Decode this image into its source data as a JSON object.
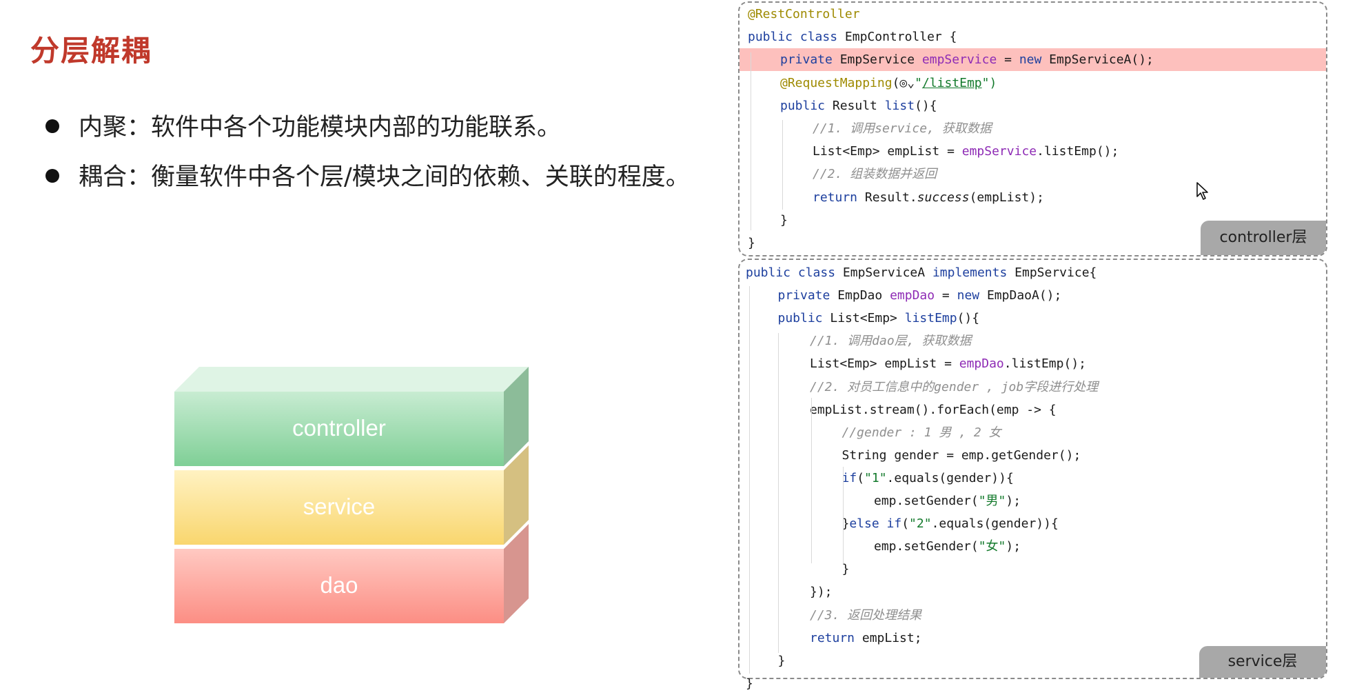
{
  "slide": {
    "title": "分层解耦",
    "bullets": [
      "内聚：软件中各个功能模块内部的功能联系。",
      "耦合：衡量软件中各个层/模块之间的依赖、关联的程度。"
    ]
  },
  "diagram": {
    "layers": [
      "controller",
      "service",
      "dao"
    ],
    "colors": {
      "controller": [
        "#c8ecd2",
        "#7fcf96"
      ],
      "service": [
        "#fff2c2",
        "#f9d66e"
      ],
      "dao": [
        "#ffc9c2",
        "#fc8e84"
      ]
    }
  },
  "controller_panel": {
    "tag": "controller层",
    "lines": [
      {
        "indent": 0,
        "tokens": [
          {
            "t": "@RestController",
            "c": "ann"
          }
        ]
      },
      {
        "indent": 0,
        "tokens": [
          {
            "t": "public class ",
            "c": "kw"
          },
          {
            "t": "EmpController {",
            "c": ""
          }
        ]
      },
      {
        "indent": 1,
        "highlight": true,
        "tokens": [
          {
            "t": "private ",
            "c": "kw"
          },
          {
            "t": "EmpService ",
            "c": ""
          },
          {
            "t": "empService",
            "c": "fld"
          },
          {
            "t": " = ",
            "c": ""
          },
          {
            "t": "new ",
            "c": "kw"
          },
          {
            "t": "EmpServiceA();",
            "c": ""
          }
        ]
      },
      {
        "indent": 1,
        "tokens": [
          {
            "t": "@RequestMapping",
            "c": "ann"
          },
          {
            "t": "(",
            "c": ""
          },
          {
            "t": "◎⌄",
            "c": "globe"
          },
          {
            "t": "\"",
            "c": "str"
          },
          {
            "t": "/listEmp",
            "c": "path"
          },
          {
            "t": "\")",
            "c": "str"
          }
        ]
      },
      {
        "indent": 1,
        "tokens": [
          {
            "t": "public ",
            "c": "kw"
          },
          {
            "t": "Result ",
            "c": ""
          },
          {
            "t": "list",
            "c": "kw"
          },
          {
            "t": "(){",
            "c": ""
          }
        ]
      },
      {
        "indent": 2,
        "tokens": [
          {
            "t": "//1. 调用service, 获取数据",
            "c": "cmt"
          }
        ]
      },
      {
        "indent": 2,
        "tokens": [
          {
            "t": "List<Emp> empList = ",
            "c": ""
          },
          {
            "t": "empService",
            "c": "fld"
          },
          {
            "t": ".listEmp();",
            "c": ""
          }
        ]
      },
      {
        "indent": 2,
        "tokens": [
          {
            "t": "//2. 组装数据并返回",
            "c": "cmt"
          }
        ]
      },
      {
        "indent": 2,
        "tokens": [
          {
            "t": "return ",
            "c": "kw"
          },
          {
            "t": "Result.",
            "c": ""
          },
          {
            "t": "success",
            "c": "static"
          },
          {
            "t": "(empList);",
            "c": ""
          }
        ]
      },
      {
        "indent": 1,
        "tokens": [
          {
            "t": "}",
            "c": ""
          }
        ]
      },
      {
        "indent": 0,
        "tokens": [
          {
            "t": "}",
            "c": ""
          }
        ]
      }
    ]
  },
  "service_panel": {
    "tag": "service层",
    "lines": [
      {
        "indent": 0,
        "tokens": [
          {
            "t": "public class ",
            "c": "kw"
          },
          {
            "t": "EmpServiceA ",
            "c": ""
          },
          {
            "t": "implements ",
            "c": "kw"
          },
          {
            "t": "EmpService{",
            "c": ""
          }
        ]
      },
      {
        "indent": 1,
        "tokens": [
          {
            "t": "private ",
            "c": "kw"
          },
          {
            "t": "EmpDao ",
            "c": ""
          },
          {
            "t": "empDao",
            "c": "fld"
          },
          {
            "t": " = ",
            "c": ""
          },
          {
            "t": "new ",
            "c": "kw"
          },
          {
            "t": "EmpDaoA();",
            "c": ""
          }
        ]
      },
      {
        "indent": 1,
        "tokens": [
          {
            "t": "public ",
            "c": "kw"
          },
          {
            "t": "List<Emp> ",
            "c": ""
          },
          {
            "t": "listEmp",
            "c": "kw"
          },
          {
            "t": "(){",
            "c": ""
          }
        ]
      },
      {
        "indent": 2,
        "tokens": [
          {
            "t": "//1. 调用dao层, 获取数据",
            "c": "cmt"
          }
        ]
      },
      {
        "indent": 2,
        "tokens": [
          {
            "t": "List<Emp> empList = ",
            "c": ""
          },
          {
            "t": "empDao",
            "c": "fld"
          },
          {
            "t": ".listEmp();",
            "c": ""
          }
        ]
      },
      {
        "indent": 2,
        "tokens": [
          {
            "t": "//2. 对员工信息中的gender , job字段进行处理",
            "c": "cmt"
          }
        ]
      },
      {
        "indent": 2,
        "tokens": [
          {
            "t": "empList.stream().forEach(emp -> {",
            "c": ""
          }
        ]
      },
      {
        "indent": 3,
        "tokens": [
          {
            "t": "//gender : 1 男 , 2 女",
            "c": "cmt"
          }
        ]
      },
      {
        "indent": 3,
        "tokens": [
          {
            "t": "String gender = emp.getGender();",
            "c": ""
          }
        ]
      },
      {
        "indent": 3,
        "tokens": [
          {
            "t": "if",
            "c": "kw"
          },
          {
            "t": "(",
            "c": ""
          },
          {
            "t": "\"1\"",
            "c": "str"
          },
          {
            "t": ".equals(gender)){",
            "c": ""
          }
        ]
      },
      {
        "indent": 4,
        "tokens": [
          {
            "t": "emp.setGender(",
            "c": ""
          },
          {
            "t": "\"男\"",
            "c": "str"
          },
          {
            "t": ");",
            "c": ""
          }
        ]
      },
      {
        "indent": 3,
        "tokens": [
          {
            "t": "}",
            "c": ""
          },
          {
            "t": "else if",
            "c": "kw"
          },
          {
            "t": "(",
            "c": ""
          },
          {
            "t": "\"2\"",
            "c": "str"
          },
          {
            "t": ".equals(gender)){",
            "c": ""
          }
        ]
      },
      {
        "indent": 4,
        "tokens": [
          {
            "t": "emp.setGender(",
            "c": ""
          },
          {
            "t": "\"女\"",
            "c": "str"
          },
          {
            "t": ");",
            "c": ""
          }
        ]
      },
      {
        "indent": 3,
        "tokens": [
          {
            "t": "}",
            "c": ""
          }
        ]
      },
      {
        "indent": 2,
        "tokens": [
          {
            "t": "});",
            "c": ""
          }
        ]
      },
      {
        "indent": 2,
        "tokens": [
          {
            "t": "//3. 返回处理结果",
            "c": "cmt"
          }
        ]
      },
      {
        "indent": 2,
        "tokens": [
          {
            "t": "return ",
            "c": "kw"
          },
          {
            "t": "empList;",
            "c": ""
          }
        ]
      },
      {
        "indent": 1,
        "tokens": [
          {
            "t": "}",
            "c": ""
          }
        ]
      },
      {
        "indent": 0,
        "tokens": [
          {
            "t": "}",
            "c": ""
          }
        ]
      }
    ]
  }
}
